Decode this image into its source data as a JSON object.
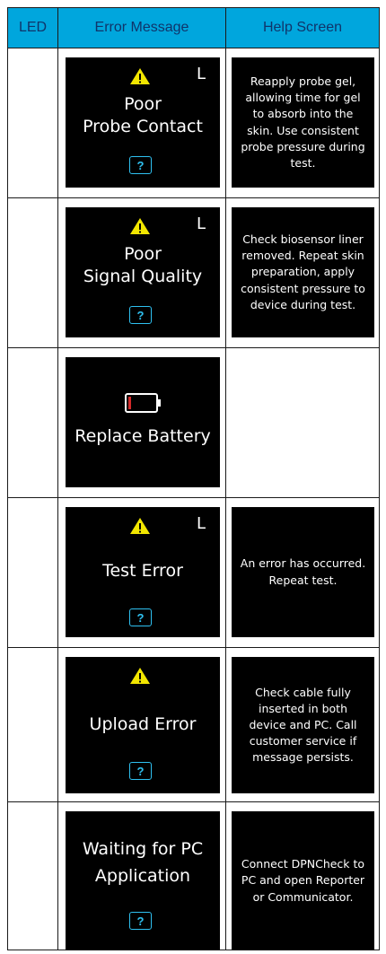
{
  "headers": {
    "led": "LED",
    "message": "Error Message",
    "help": "Help Screen"
  },
  "rows": [
    {
      "id": "poor-probe-contact",
      "side_label": "L",
      "lines": [
        "Poor",
        "Probe Contact"
      ],
      "help_button": "?",
      "help_text": "Reapply probe gel, allowing time for gel to absorb into the skin. Use consistent probe pressure during test."
    },
    {
      "id": "poor-signal-quality",
      "side_label": "L",
      "lines": [
        "Poor",
        "Signal Quality"
      ],
      "help_button": "?",
      "help_text": "Check biosensor liner removed. Repeat skin preparation, apply consistent pressure to device during test."
    },
    {
      "id": "replace-battery",
      "lines": [
        "Replace Battery"
      ]
    },
    {
      "id": "test-error",
      "side_label": "L",
      "lines": [
        "Test Error"
      ],
      "help_button": "?",
      "help_text": "An error has occurred. Repeat test."
    },
    {
      "id": "upload-error",
      "lines": [
        "Upload Error"
      ],
      "help_button": "?",
      "help_text": "Check cable fully inserted in both device and PC. Call customer service if message persists."
    },
    {
      "id": "waiting-for-pc",
      "lines": [
        "Waiting for PC",
        "Application"
      ],
      "help_button": "?",
      "help_text": "Connect DPNCheck to PC and open Reporter or Communicator."
    }
  ],
  "icons": {
    "warning": "warning-triangle-icon",
    "battery": "low-battery-icon"
  },
  "colors": {
    "header_bg": "#00a6dd",
    "header_text": "#10346a",
    "screen_bg": "#000000",
    "warning": "#f2e600",
    "help_button": "#2fc1f1",
    "battery_low": "#d42a2a"
  }
}
